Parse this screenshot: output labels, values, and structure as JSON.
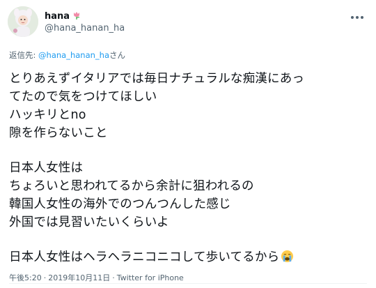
{
  "author": {
    "display_name": "hana",
    "handle": "@hana_hanan_ha"
  },
  "reply": {
    "prefix": "返信先: ",
    "mention": "@hana_hanan_ha",
    "suffix": "さん"
  },
  "tweet": {
    "lines": [
      "とりあえずイタリアでは毎日ナチュラルな痴漢にあっ",
      "てたので気をつけてほしい",
      "ハッキリとno",
      "隙を作らないこと",
      "",
      "日本人女性は",
      "ちょろいと思われてるから余計に狙われるの",
      "韓国人女性の海外でのつんつんした感じ",
      "外国では見習いたいくらいよ",
      "",
      "日本人女性はヘラヘラニコニコして歩いてるから"
    ],
    "emoji_icon": "crying-face-emoji"
  },
  "meta": {
    "time": "午後5:20",
    "separator": "·",
    "date": "2019年10月11日",
    "source": "Twitter for iPhone"
  },
  "colors": {
    "text": "#0f1419",
    "secondary": "#536471",
    "link": "#1d9bf0",
    "flower": "#f28aa8"
  }
}
